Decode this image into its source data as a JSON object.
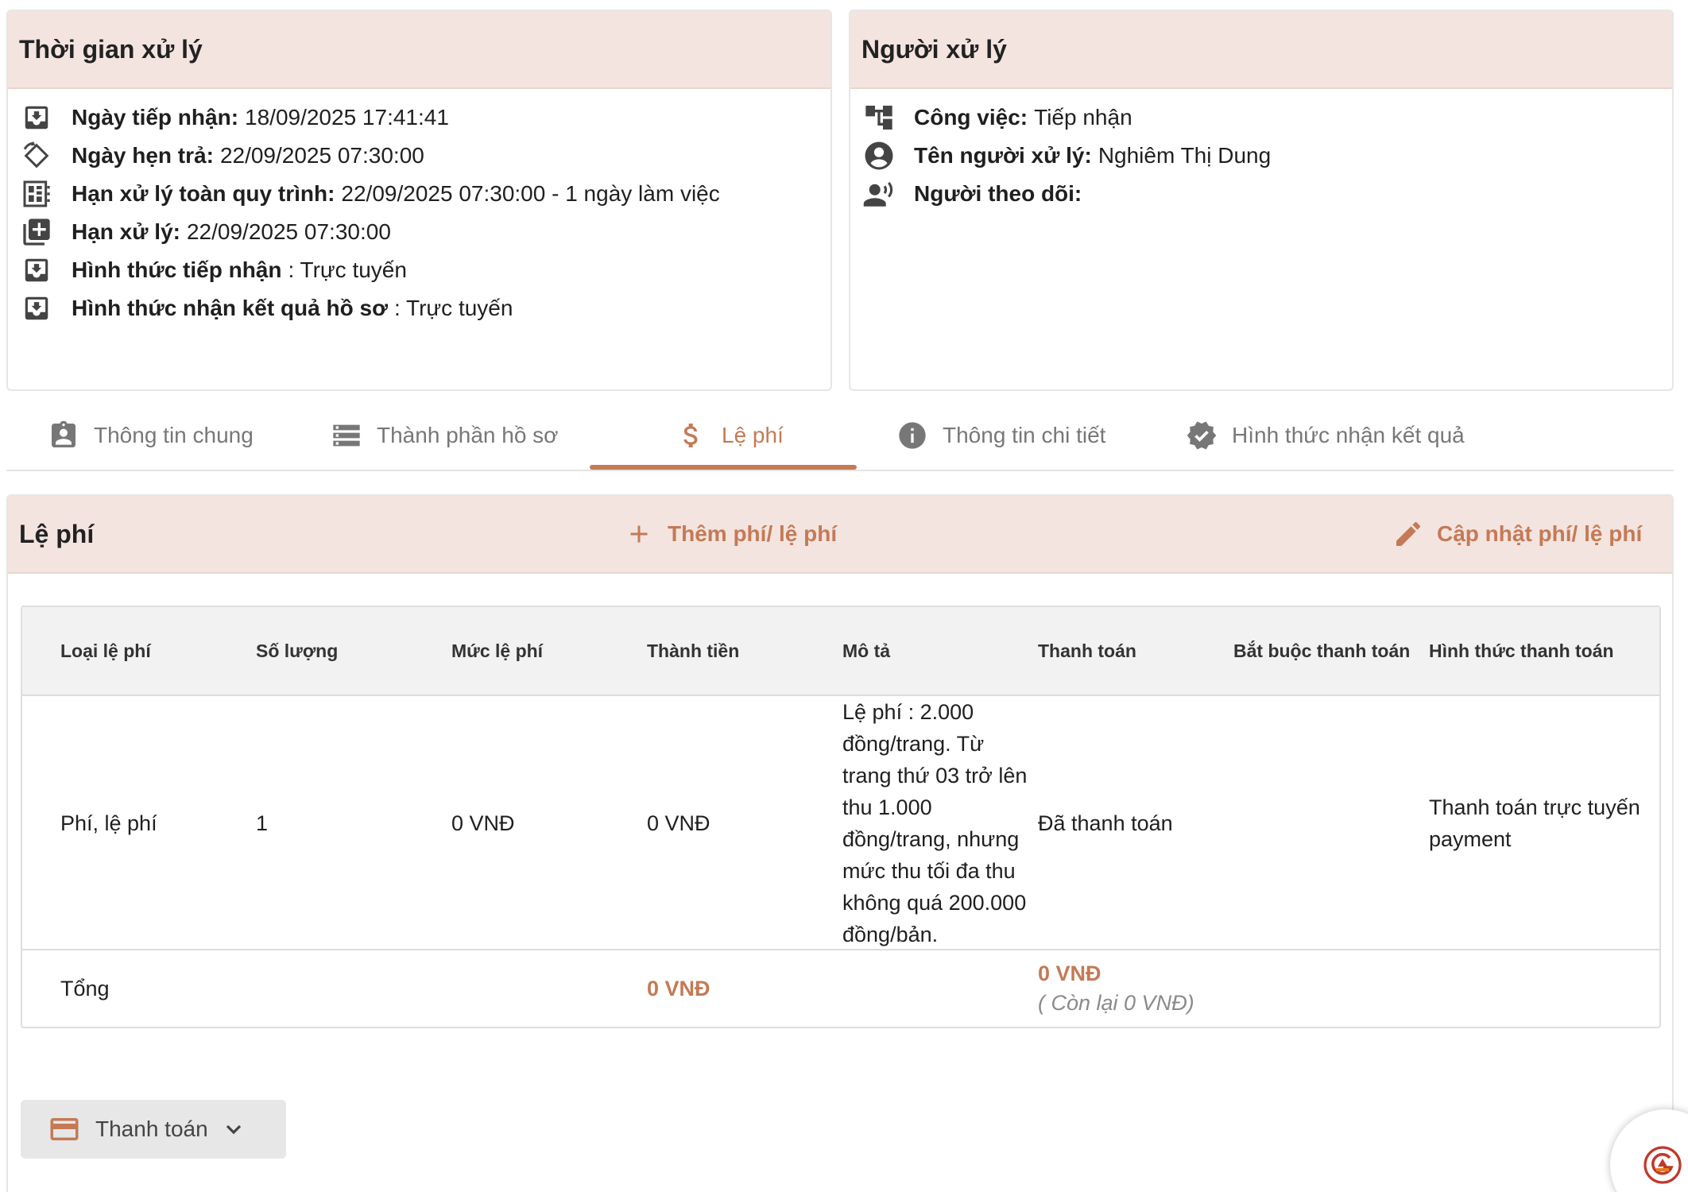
{
  "time_panel": {
    "title": "Thời gian xử lý",
    "rows": [
      {
        "icon": "inbox-download-icon",
        "label": "Ngày tiếp nhận:",
        "value": "18/09/2025 17:41:41"
      },
      {
        "icon": "rotate-calendar-icon",
        "label": "Ngày hẹn trả:",
        "value": "22/09/2025 07:30:00"
      },
      {
        "icon": "dashboard-grid-icon",
        "label": "Hạn xử lý toàn quy trình:",
        "value": "22/09/2025 07:30:00 - 1 ngày làm việc"
      },
      {
        "icon": "library-add-icon",
        "label": "Hạn xử lý:",
        "value": "22/09/2025 07:30:00"
      },
      {
        "icon": "inbox-download-icon",
        "label": "Hình thức tiếp nhận",
        "value": ": Trực tuyến"
      },
      {
        "icon": "inbox-download-icon",
        "label": "Hình thức nhận kết quả hồ sơ",
        "value": ": Trực tuyến"
      }
    ]
  },
  "handler_panel": {
    "title": "Người xử lý",
    "rows": [
      {
        "icon": "account-tree-icon",
        "label": "Công việc:",
        "value": "Tiếp nhận"
      },
      {
        "icon": "account-circle-icon",
        "label": "Tên người xử lý:",
        "value": "Nghiêm Thị Dung"
      },
      {
        "icon": "record-voice-icon",
        "label": "Người theo dõi:",
        "value": ""
      }
    ]
  },
  "tabs": [
    {
      "label": "Thông tin chung",
      "icon": "assignment-ind-icon",
      "active": false
    },
    {
      "label": "Thành phần hồ sơ",
      "icon": "storage-icon",
      "active": false
    },
    {
      "label": "Lệ phí",
      "icon": "dollar-icon",
      "active": true
    },
    {
      "label": "Thông tin chi tiết",
      "icon": "info-icon",
      "active": false
    },
    {
      "label": "Hình thức nhận kết quả",
      "icon": "verified-badge-icon",
      "active": false
    }
  ],
  "fee_panel": {
    "title": "Lệ phí",
    "add_button": "Thêm phí/ lệ phí",
    "update_button": "Cập nhật phí/ lệ phí",
    "table": {
      "headers": [
        "Loại lệ phí",
        "Số lượng",
        "Mức lệ phí",
        "Thành tiền",
        "Mô tả",
        "Thanh toán",
        "Bắt buộc thanh toán",
        "Hình thức thanh toán"
      ],
      "rows": [
        {
          "type": "Phí, lệ phí",
          "quantity": "1",
          "rate": "0 VNĐ",
          "amount": "0 VNĐ",
          "description": "Lệ phí : 2.000 đồng/trang. Từ trang thứ 03 trở lên thu 1.000 đồng/trang, nhưng mức thu tối đa thu không quá 200.000 đồng/bản.",
          "payment_status": "Đã thanh toán",
          "required": "",
          "payment_method": "Thanh toán trực tuyến payment"
        }
      ],
      "total": {
        "label": "Tổng",
        "amount": "0 VNĐ",
        "paid": "0 VNĐ",
        "remaining": "( Còn lại 0 VNĐ)"
      }
    },
    "pay_button": "Thanh toán"
  },
  "colors": {
    "accent": "#c47a56",
    "header_bg": "#f4e4e0",
    "table_header_bg": "#f2f2f2"
  }
}
